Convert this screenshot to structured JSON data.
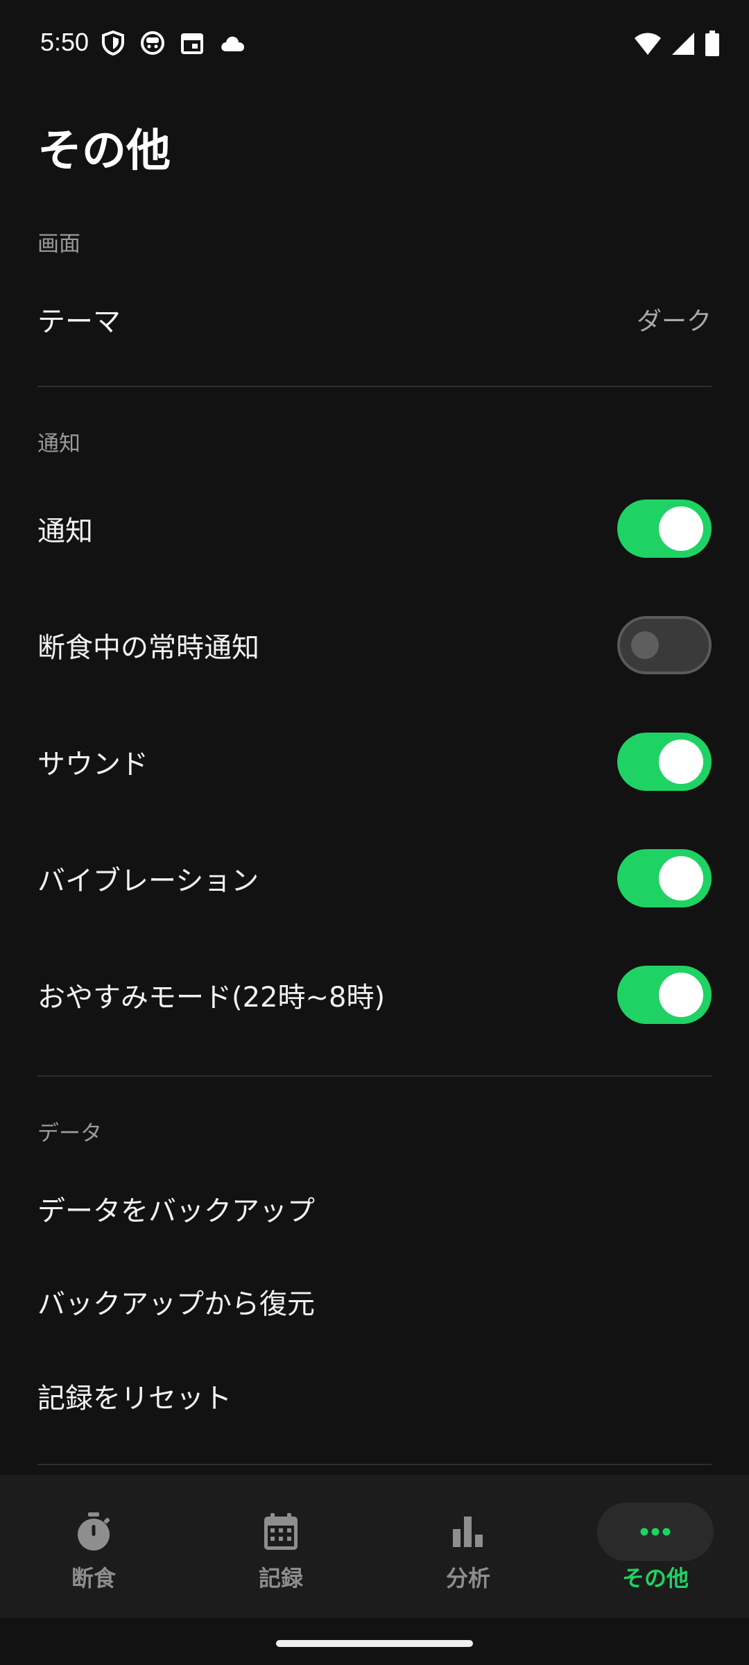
{
  "status_bar": {
    "time": "5:50",
    "left_icons": [
      "shield-icon",
      "face-icon",
      "calendar-icon",
      "cloud-icon"
    ],
    "right_icons": [
      "wifi-icon",
      "cellular-signal-icon",
      "battery-icon"
    ]
  },
  "page": {
    "title": "その他"
  },
  "sections": {
    "display": {
      "header": "画面",
      "theme_label": "テーマ",
      "theme_value": "ダーク"
    },
    "notifications": {
      "header": "通知",
      "items": [
        {
          "label": "通知",
          "on": true
        },
        {
          "label": "断食中の常時通知",
          "on": false
        },
        {
          "label": "サウンド",
          "on": true
        },
        {
          "label": "バイブレーション",
          "on": true
        },
        {
          "label": "おやすみモード(22時~8時)",
          "on": true
        }
      ]
    },
    "data": {
      "header": "データ",
      "items": [
        {
          "label": "データをバックアップ"
        },
        {
          "label": "バックアップから復元"
        },
        {
          "label": "記録をリセット"
        }
      ]
    }
  },
  "bottom_nav": {
    "items": [
      {
        "label": "断食",
        "icon": "stopwatch-icon",
        "active": false
      },
      {
        "label": "記録",
        "icon": "calendar-icon",
        "active": false
      },
      {
        "label": "分析",
        "icon": "bar-chart-icon",
        "active": false
      },
      {
        "label": "その他",
        "icon": "more-horizontal-icon",
        "active": true
      }
    ]
  },
  "colors": {
    "accent": "#1fd264",
    "background": "#121212",
    "nav_background": "#1c1c1c"
  }
}
